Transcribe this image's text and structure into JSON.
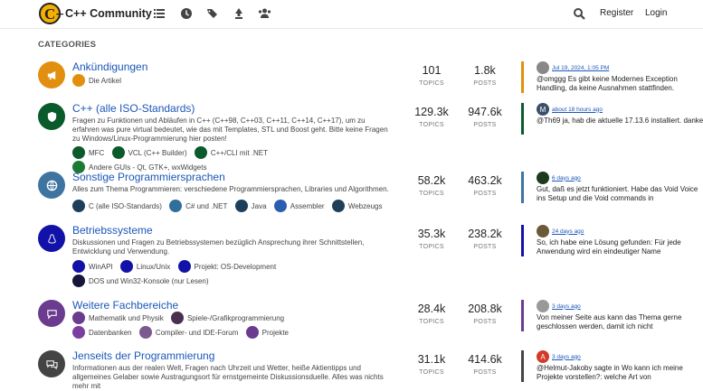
{
  "header": {
    "brand": "C++ Community",
    "logo_text": "C+",
    "icons": [
      "list-icon",
      "clock-icon",
      "tags-icon",
      "popular-icon",
      "users-icon",
      "search-icon"
    ],
    "register": "Register",
    "login": "Login"
  },
  "section_title": "CATEGORIES",
  "topics_label": "TOPICS",
  "posts_label": "POSTS",
  "categories": [
    {
      "name": "Ankündigungen",
      "color": "#e28f10",
      "icon": "bullhorn-icon",
      "description": "",
      "subcategories": [
        {
          "name": "Die Artikel",
          "color": "#e28f10"
        }
      ],
      "topics": "101",
      "posts": "1.8k",
      "teaser": {
        "color": "#e28f10",
        "avatar_color": "#888888",
        "avatar_letter": "",
        "time": "Jul 19, 2024, 1:05 PM",
        "text": "@omggg Es gibt keine Modernes Exception Handling, da keine Ausnahmen stattfinden."
      }
    },
    {
      "name": "C++ (alle ISO-Standards)",
      "color": "#0a5a2b",
      "icon": "shield-icon",
      "description": "Fragen zu Funktionen und Abläufen in C++ (C++98, C++03, C++11, C++14, C++17), um zu erfahren was pure virtual bedeutet, wie das mit Templates, STL und Boost geht. Bitte keine Fragen zu Windows/Linux-Programmierung hier posten!",
      "subcategories": [
        {
          "name": "MFC",
          "color": "#0a5a2b"
        },
        {
          "name": "VCL (C++ Builder)",
          "color": "#0a5a2b"
        },
        {
          "name": "C++/CLI mit .NET",
          "color": "#0a5a2b"
        },
        {
          "name": "Andere GUIs - Qt, GTK+, wxWidgets",
          "color": "#1d7a35"
        }
      ],
      "topics": "129.3k",
      "posts": "947.6k",
      "teaser": {
        "color": "#0a5a2b",
        "avatar_color": "#3a4f6a",
        "avatar_letter": "M",
        "time": "about 18 hours ago",
        "text": "@Th69 ja, hab die aktuelle 17.13.6 installiert. danke!"
      }
    },
    {
      "name": "Sonstige Programmiersprachen",
      "color": "#4074a0",
      "icon": "globe-icon",
      "description": "Alles zum Thema Programmieren: verschiedene Programmiersprachen, Libraries und Algorithmen.",
      "subcategories": [
        {
          "name": "C (alle ISO-Standards)",
          "color": "#1e3f5a"
        },
        {
          "name": "C# und .NET",
          "color": "#2f6f99"
        },
        {
          "name": "Java",
          "color": "#1e3f5a"
        },
        {
          "name": "Assembler",
          "color": "#2a5fb0"
        },
        {
          "name": "Webzeugs",
          "color": "#1e3f5a"
        }
      ],
      "topics": "58.2k",
      "posts": "463.2k",
      "teaser": {
        "color": "#4074a0",
        "avatar_color": "#1d3a1d",
        "avatar_letter": "",
        "time": "6 days ago",
        "text": "Gut, daß es jetzt funktioniert. Habe das Void Voice ins Setup und die Void commands in"
      }
    },
    {
      "name": "Betriebssysteme",
      "color": "#1212a8",
      "icon": "linux-icon",
      "description": "Diskussionen und Fragen zu Betriebssystemen bezüglich Ansprechung ihrer Schnittstellen, Entwicklung und Verwendung.",
      "subcategories": [
        {
          "name": "WinAPI",
          "color": "#1212a8"
        },
        {
          "name": "Linux/Unix",
          "color": "#1212a8"
        },
        {
          "name": "Projekt: OS-Development",
          "color": "#1212a8"
        },
        {
          "name": "DOS und Win32-Konsole (nur Lesen)",
          "color": "#16163a"
        }
      ],
      "topics": "35.3k",
      "posts": "238.2k",
      "teaser": {
        "color": "#1212a8",
        "avatar_color": "#6a5a3a",
        "avatar_letter": "",
        "time": "24 days ago",
        "text": "So, ich habe eine Lösung gefunden: Für jede Anwendung wird ein eindeutiger Name"
      }
    },
    {
      "name": "Weitere Fachbereiche",
      "color": "#6a3b8f",
      "icon": "comment-icon",
      "description": "",
      "subcategories": [
        {
          "name": "Mathematik und Physik",
          "color": "#6a3b8f"
        },
        {
          "name": "Spiele-/Grafikprogrammierung",
          "color": "#4a3050"
        },
        {
          "name": "Datenbanken",
          "color": "#7a3fa0"
        },
        {
          "name": "Compiler- und IDE-Forum",
          "color": "#7a5a8f"
        },
        {
          "name": "Projekte",
          "color": "#6a3b8f"
        }
      ],
      "topics": "28.4k",
      "posts": "208.8k",
      "teaser": {
        "color": "#6a3b8f",
        "avatar_color": "#999999",
        "avatar_letter": "",
        "time": "3 days ago",
        "text": "Von meiner Seite aus kann das Thema gerne geschlossen werden, damit ich nicht"
      }
    },
    {
      "name": "Jenseits der Programmierung",
      "color": "#444444",
      "icon": "comments-icon",
      "description": "Informationen aus der realen Welt, Fragen nach Uhrzeit und Wetter, heiße Aktientipps und allgemeines Gelaber sowie Austragungsort für ernstgemeinte Diskussionsduelle. Alles was nichts mehr mit",
      "subcategories": [],
      "topics": "31.1k",
      "posts": "414.6k",
      "teaser": {
        "color": "#444444",
        "avatar_color": "#d23a2a",
        "avatar_letter": "A",
        "time": "3 days ago",
        "text": "@Helmut-Jakoby sagte in Wo kann ich meine Projekte vorstellen?: welche Art von"
      }
    }
  ]
}
